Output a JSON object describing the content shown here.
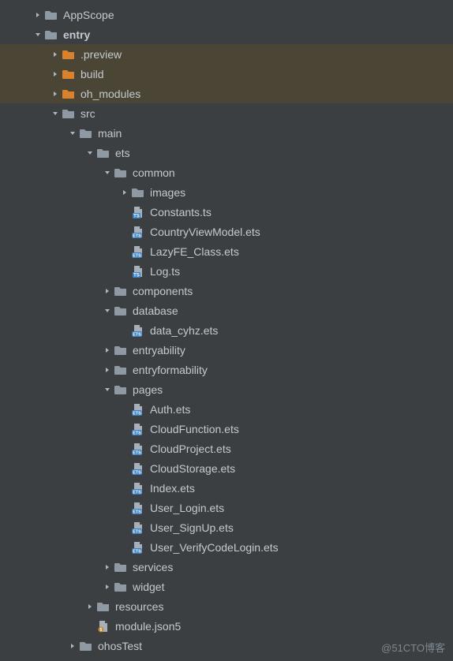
{
  "watermark": "@51CTO博客",
  "tree": [
    {
      "label": "AppScope",
      "icon": "folder-gray",
      "chev": "right",
      "indent": 1,
      "bold": false,
      "sel": false
    },
    {
      "label": "entry",
      "icon": "folder-gray",
      "chev": "down",
      "indent": 1,
      "bold": true,
      "sel": false
    },
    {
      "label": ".preview",
      "icon": "folder-orange",
      "chev": "right",
      "indent": 2,
      "bold": false,
      "sel": true
    },
    {
      "label": "build",
      "icon": "folder-orange",
      "chev": "right",
      "indent": 2,
      "bold": false,
      "sel": true
    },
    {
      "label": "oh_modules",
      "icon": "folder-orange",
      "chev": "right",
      "indent": 2,
      "bold": false,
      "sel": true
    },
    {
      "label": "src",
      "icon": "folder-gray",
      "chev": "down",
      "indent": 2,
      "bold": false,
      "sel": false
    },
    {
      "label": "main",
      "icon": "folder-gray",
      "chev": "down",
      "indent": 3,
      "bold": false,
      "sel": false
    },
    {
      "label": "ets",
      "icon": "folder-gray",
      "chev": "down",
      "indent": 4,
      "bold": false,
      "sel": false
    },
    {
      "label": "common",
      "icon": "folder-gray",
      "chev": "down",
      "indent": 5,
      "bold": false,
      "sel": false
    },
    {
      "label": "images",
      "icon": "folder-gray",
      "chev": "right",
      "indent": 6,
      "bold": false,
      "sel": false
    },
    {
      "label": "Constants.ts",
      "icon": "file-ts",
      "chev": "none",
      "indent": 6,
      "bold": false,
      "sel": false
    },
    {
      "label": "CountryViewModel.ets",
      "icon": "file-ets",
      "chev": "none",
      "indent": 6,
      "bold": false,
      "sel": false
    },
    {
      "label": "LazyFE_Class.ets",
      "icon": "file-ets",
      "chev": "none",
      "indent": 6,
      "bold": false,
      "sel": false
    },
    {
      "label": "Log.ts",
      "icon": "file-ts",
      "chev": "none",
      "indent": 6,
      "bold": false,
      "sel": false
    },
    {
      "label": "components",
      "icon": "folder-gray",
      "chev": "right",
      "indent": 5,
      "bold": false,
      "sel": false
    },
    {
      "label": "database",
      "icon": "folder-gray",
      "chev": "down",
      "indent": 5,
      "bold": false,
      "sel": false
    },
    {
      "label": "data_cyhz.ets",
      "icon": "file-ets",
      "chev": "none",
      "indent": 6,
      "bold": false,
      "sel": false
    },
    {
      "label": "entryability",
      "icon": "folder-gray",
      "chev": "right",
      "indent": 5,
      "bold": false,
      "sel": false
    },
    {
      "label": "entryformability",
      "icon": "folder-gray",
      "chev": "right",
      "indent": 5,
      "bold": false,
      "sel": false
    },
    {
      "label": "pages",
      "icon": "folder-gray",
      "chev": "down",
      "indent": 5,
      "bold": false,
      "sel": false
    },
    {
      "label": "Auth.ets",
      "icon": "file-ets",
      "chev": "none",
      "indent": 6,
      "bold": false,
      "sel": false
    },
    {
      "label": "CloudFunction.ets",
      "icon": "file-ets",
      "chev": "none",
      "indent": 6,
      "bold": false,
      "sel": false
    },
    {
      "label": "CloudProject.ets",
      "icon": "file-ets",
      "chev": "none",
      "indent": 6,
      "bold": false,
      "sel": false
    },
    {
      "label": "CloudStorage.ets",
      "icon": "file-ets",
      "chev": "none",
      "indent": 6,
      "bold": false,
      "sel": false
    },
    {
      "label": "Index.ets",
      "icon": "file-ets",
      "chev": "none",
      "indent": 6,
      "bold": false,
      "sel": false
    },
    {
      "label": "User_Login.ets",
      "icon": "file-ets",
      "chev": "none",
      "indent": 6,
      "bold": false,
      "sel": false
    },
    {
      "label": "User_SignUp.ets",
      "icon": "file-ets",
      "chev": "none",
      "indent": 6,
      "bold": false,
      "sel": false
    },
    {
      "label": "User_VerifyCodeLogin.ets",
      "icon": "file-ets",
      "chev": "none",
      "indent": 6,
      "bold": false,
      "sel": false
    },
    {
      "label": "services",
      "icon": "folder-gray",
      "chev": "right",
      "indent": 5,
      "bold": false,
      "sel": false
    },
    {
      "label": "widget",
      "icon": "folder-gray",
      "chev": "right",
      "indent": 5,
      "bold": false,
      "sel": false
    },
    {
      "label": "resources",
      "icon": "folder-gray",
      "chev": "right",
      "indent": 4,
      "bold": false,
      "sel": false
    },
    {
      "label": "module.json5",
      "icon": "file-json5",
      "chev": "none",
      "indent": 4,
      "bold": false,
      "sel": false
    },
    {
      "label": "ohosTest",
      "icon": "folder-gray",
      "chev": "right",
      "indent": 3,
      "bold": false,
      "sel": false
    }
  ]
}
